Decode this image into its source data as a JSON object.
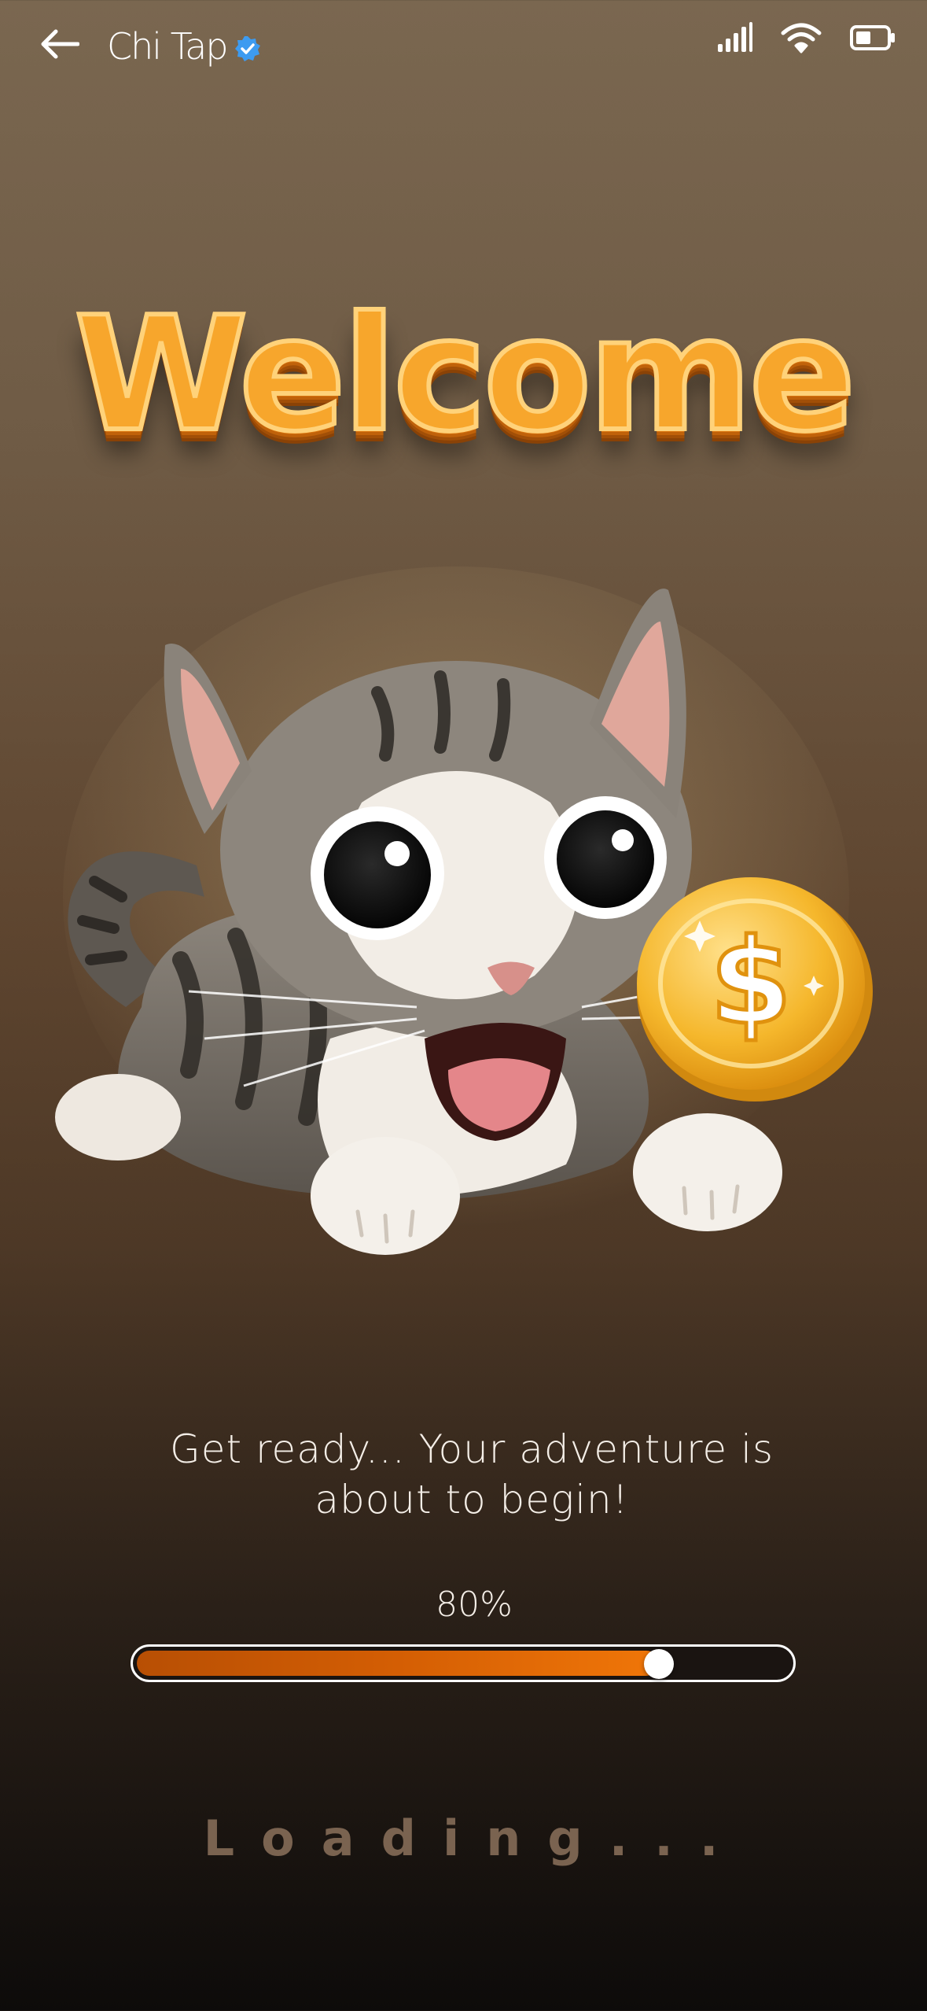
{
  "topbar": {
    "back_icon": "arrow-left-icon",
    "title": "Chi Tap",
    "verified_icon": "verified-badge-icon",
    "status_icons": [
      "signal-icon",
      "wifi-icon",
      "battery-icon"
    ]
  },
  "welcome": {
    "heading": "Welcome"
  },
  "hero": {
    "image": "cat-with-coin-illustration",
    "coin_icon": "dollar-coin-icon"
  },
  "message": {
    "line1": "Get ready... Your adventure is",
    "line2": "about to begin!"
  },
  "progress": {
    "label": "80%",
    "value": 0.8
  },
  "loading": {
    "text": "Loading..."
  },
  "colors": {
    "accent": "#f07608",
    "progress_dark": "#b84f04",
    "verified": "#3d9bf0",
    "heading": "#f7a62c"
  }
}
